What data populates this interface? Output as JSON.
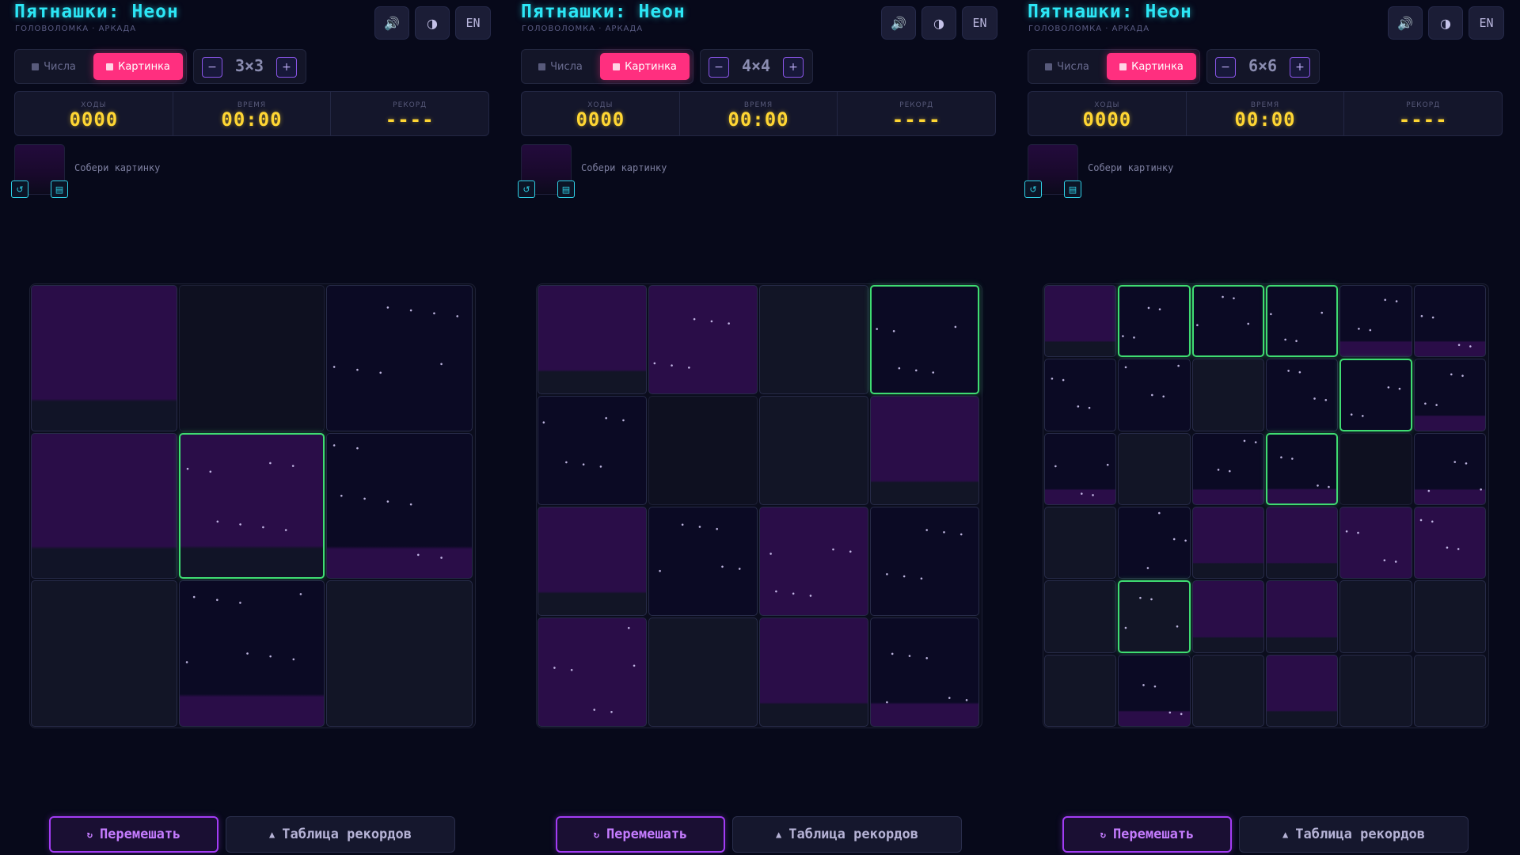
{
  "common": {
    "title": "Пятнашки: Неон",
    "subtitle": "ГОЛОВОЛОМКА · АРКАДА",
    "sound_icon": "speaker-icon",
    "theme_icon": "contrast-icon",
    "lang_label": "EN",
    "mode_numbers": "Числа",
    "mode_picture": "Картинка",
    "stats": {
      "moves_label": "ХОДЫ",
      "moves": "0000",
      "time_label": "ВРЕМЯ",
      "time": "00:00",
      "record_label": "РЕКОРД",
      "record": "----"
    },
    "hint": "Собери картинку",
    "shuffle_label": "Перемешать",
    "records_label": "Таблица рекордов",
    "colors": {
      "accent_cyan": "#2ce6f5",
      "accent_pink": "#ff2f7f",
      "accent_purple": "#a33cf5",
      "score_yellow": "#ffd633",
      "correct_green": "#3fdc72"
    }
  },
  "panels": [
    {
      "size_label": "3×3",
      "n": 3,
      "tiles": [
        {
          "kind": "a",
          "top": "purple",
          "bottom": "dark"
        },
        {
          "kind": "empty"
        },
        {
          "kind": "stars",
          "top": "night",
          "bottom": "night"
        },
        {
          "kind": "a",
          "top": "purple",
          "bottom": "dark"
        },
        {
          "kind": "correct",
          "top": "purple",
          "bottom": "dark"
        },
        {
          "kind": "stars",
          "top": "night",
          "bottom": "purple"
        },
        {
          "kind": "plain",
          "top": "gray",
          "bottom": "gray"
        },
        {
          "kind": "stars",
          "top": "night",
          "bottom": "purple"
        },
        {
          "kind": "plain",
          "top": "gray",
          "bottom": "gray"
        }
      ]
    },
    {
      "size_label": "4×4",
      "n": 4,
      "tiles": [
        {
          "kind": "a",
          "top": "purple",
          "bottom": "gray"
        },
        {
          "kind": "stars",
          "top": "purple",
          "bottom": "purple"
        },
        {
          "kind": "plain",
          "top": "gray",
          "bottom": "gray"
        },
        {
          "kind": "correct",
          "top": "night",
          "bottom": "night"
        },
        {
          "kind": "stars",
          "top": "night",
          "bottom": "night"
        },
        {
          "kind": "empty"
        },
        {
          "kind": "plain",
          "top": "gray",
          "bottom": "gray"
        },
        {
          "kind": "a",
          "top": "purple",
          "bottom": "gray"
        },
        {
          "kind": "a",
          "top": "purple",
          "bottom": "gray"
        },
        {
          "kind": "stars",
          "top": "night",
          "bottom": "night"
        },
        {
          "kind": "stars",
          "top": "purple",
          "bottom": "purple"
        },
        {
          "kind": "stars",
          "top": "night",
          "bottom": "night"
        },
        {
          "kind": "stars",
          "top": "purple",
          "bottom": "purple"
        },
        {
          "kind": "plain",
          "top": "gray",
          "bottom": "gray"
        },
        {
          "kind": "a",
          "top": "purple",
          "bottom": "gray"
        },
        {
          "kind": "stars",
          "top": "night",
          "bottom": "purple"
        }
      ]
    },
    {
      "size_label": "6×6",
      "n": 6,
      "tiles": [
        {
          "kind": "a",
          "top": "purple",
          "bottom": "gray"
        },
        {
          "kind": "correct",
          "top": "night",
          "bottom": "night"
        },
        {
          "kind": "correct",
          "top": "night",
          "bottom": "night"
        },
        {
          "kind": "correct",
          "top": "night",
          "bottom": "night"
        },
        {
          "kind": "stars",
          "top": "night",
          "bottom": "purple"
        },
        {
          "kind": "stars",
          "top": "night",
          "bottom": "purple"
        },
        {
          "kind": "stars",
          "top": "night",
          "bottom": "night"
        },
        {
          "kind": "stars",
          "top": "night",
          "bottom": "night"
        },
        {
          "kind": "plain",
          "top": "gray",
          "bottom": "gray"
        },
        {
          "kind": "stars",
          "top": "night",
          "bottom": "night"
        },
        {
          "kind": "correct",
          "top": "night",
          "bottom": "night"
        },
        {
          "kind": "stars",
          "top": "night",
          "bottom": "purple"
        },
        {
          "kind": "stars",
          "top": "night",
          "bottom": "purple"
        },
        {
          "kind": "plain",
          "top": "gray",
          "bottom": "gray"
        },
        {
          "kind": "stars",
          "top": "night",
          "bottom": "purple"
        },
        {
          "kind": "correct",
          "top": "night",
          "bottom": "purple"
        },
        {
          "kind": "empty"
        },
        {
          "kind": "stars",
          "top": "night",
          "bottom": "purple"
        },
        {
          "kind": "plain",
          "top": "gray",
          "bottom": "gray"
        },
        {
          "kind": "stars",
          "top": "night",
          "bottom": "night"
        },
        {
          "kind": "a",
          "top": "purple",
          "bottom": "gray"
        },
        {
          "kind": "a",
          "top": "purple",
          "bottom": "gray"
        },
        {
          "kind": "stars",
          "top": "purple",
          "bottom": "purple"
        },
        {
          "kind": "stars",
          "top": "purple",
          "bottom": "purple"
        },
        {
          "kind": "plain",
          "top": "gray",
          "bottom": "gray"
        },
        {
          "kind": "correct",
          "top": "gray",
          "bottom": "gray"
        },
        {
          "kind": "a",
          "top": "purple",
          "bottom": "gray"
        },
        {
          "kind": "a",
          "top": "purple",
          "bottom": "gray"
        },
        {
          "kind": "plain",
          "top": "gray",
          "bottom": "gray"
        },
        {
          "kind": "plain",
          "top": "gray",
          "bottom": "gray"
        },
        {
          "kind": "plain",
          "top": "gray",
          "bottom": "gray"
        },
        {
          "kind": "stars",
          "top": "night",
          "bottom": "purple"
        },
        {
          "kind": "plain",
          "top": "gray",
          "bottom": "gray"
        },
        {
          "kind": "a",
          "top": "purple",
          "bottom": "gray"
        },
        {
          "kind": "plain",
          "top": "gray",
          "bottom": "gray"
        },
        {
          "kind": "plain",
          "top": "gray",
          "bottom": "gray"
        }
      ]
    }
  ]
}
